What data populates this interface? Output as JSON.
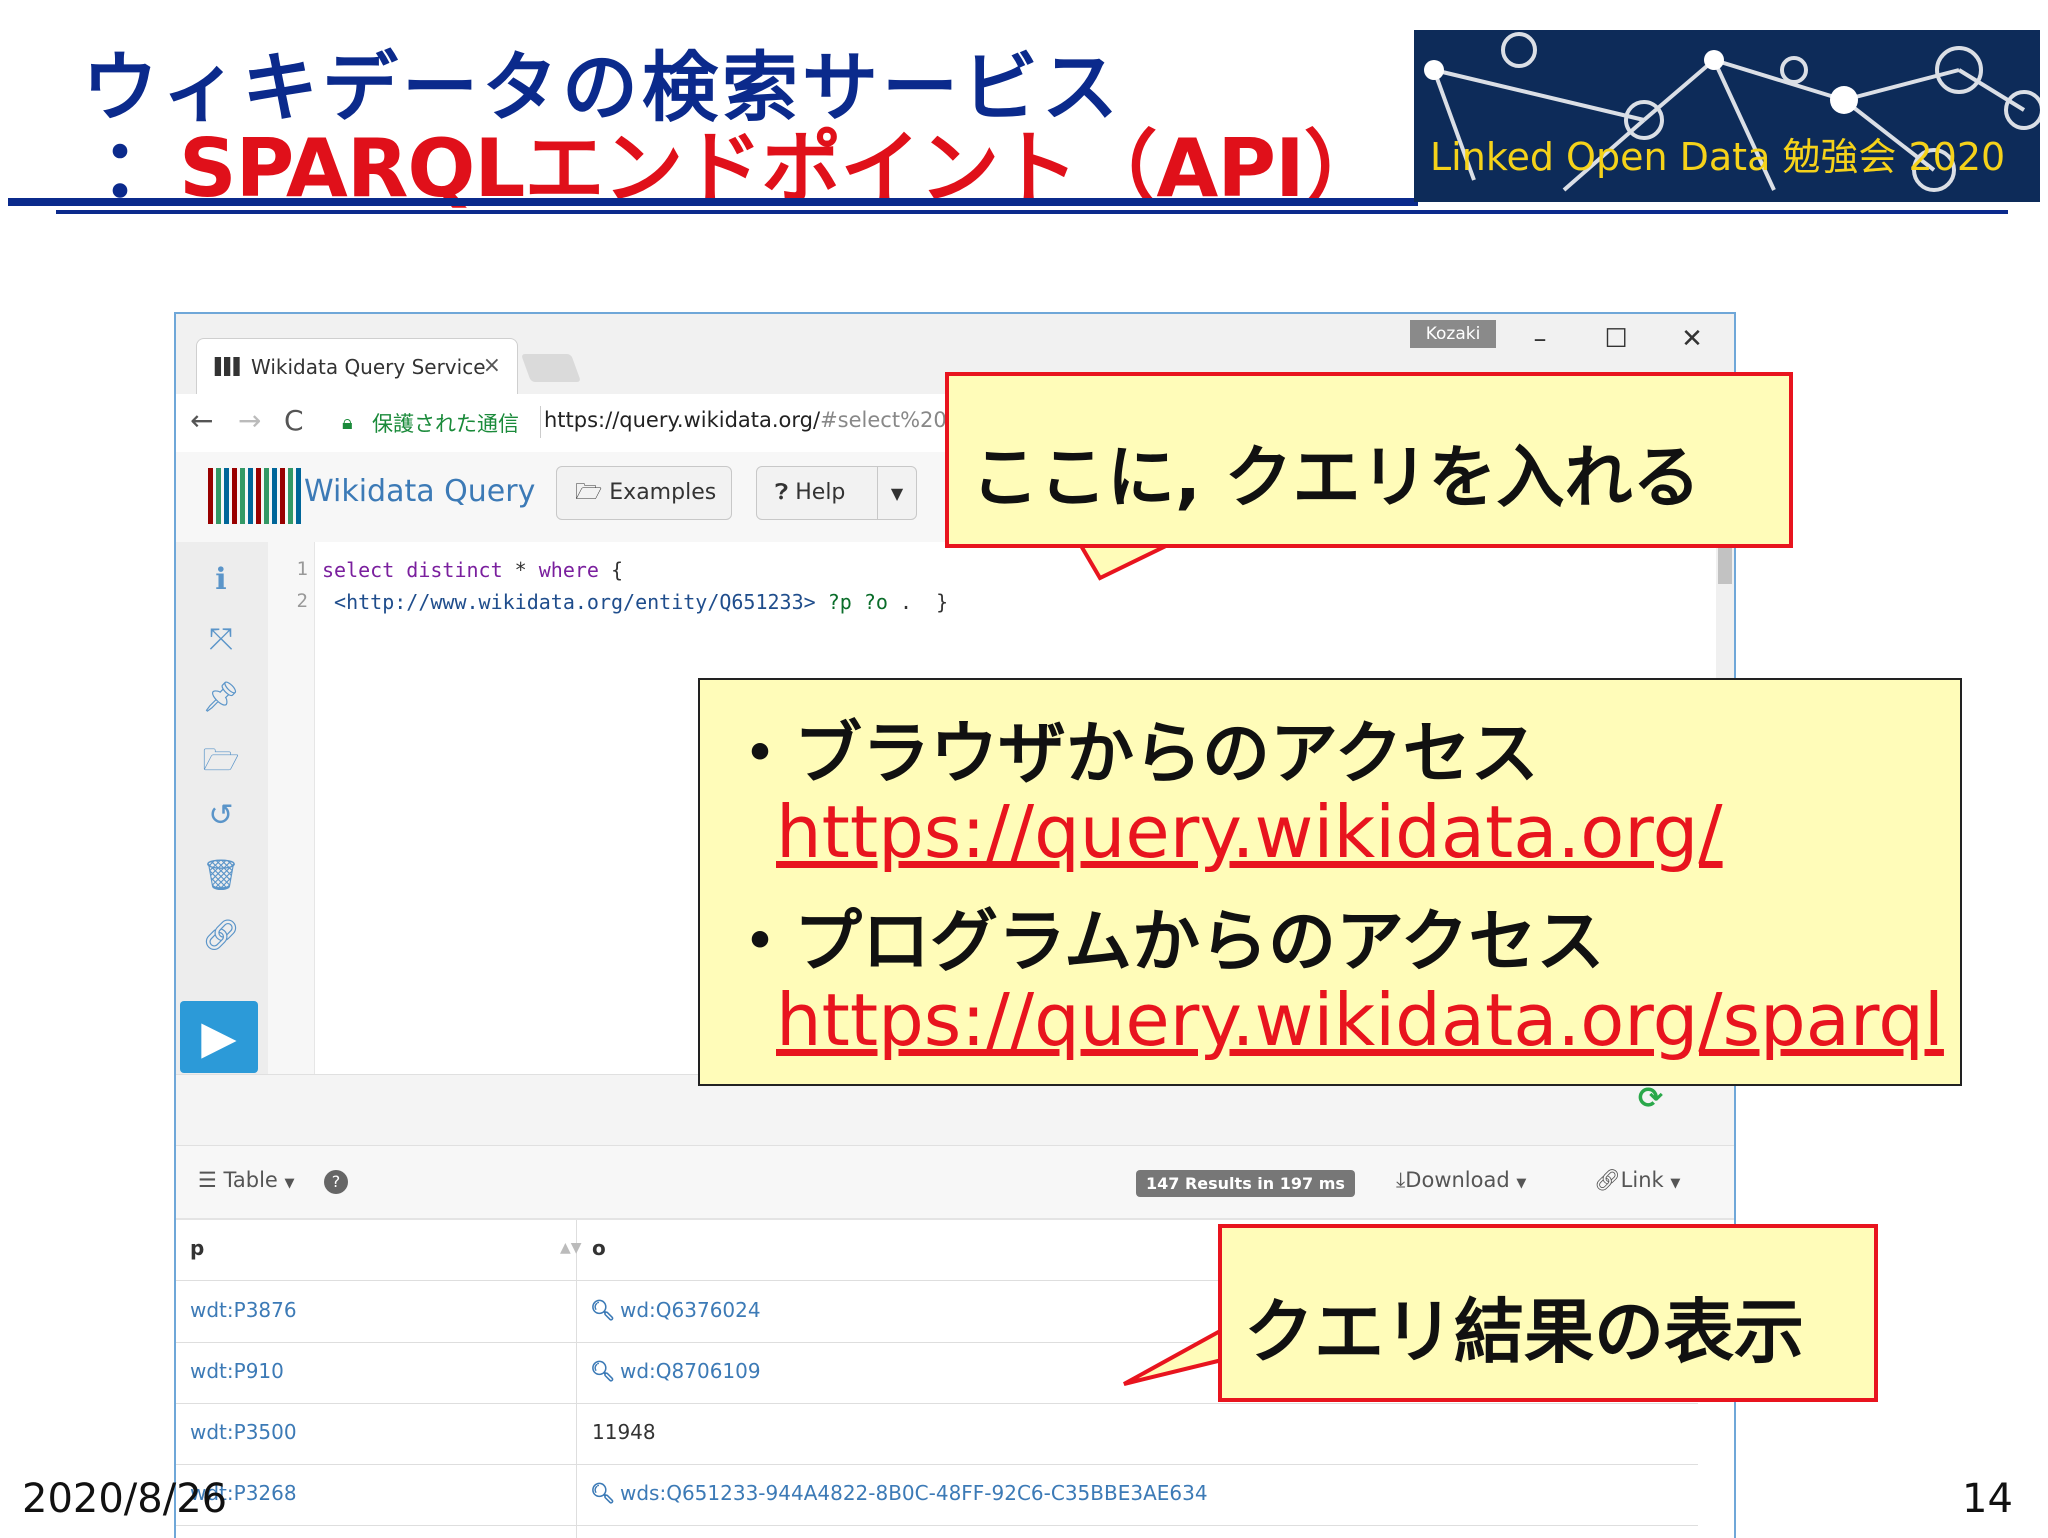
{
  "slide": {
    "title_line1": "ウィキデータの検索サービス",
    "title_line2_colon": "：",
    "title_line2": "SPARQLエンドポイント（API）",
    "banner": "Linked Open Data 勉強会 2020",
    "date": "2020/8/26",
    "page_number": "14"
  },
  "browser": {
    "tab_title": "Wikidata Query Service",
    "tab_close": "×",
    "user_badge": "Kozaki",
    "minimize": "–",
    "maximize": "☐",
    "close": "✕",
    "back": "←",
    "forward": "→",
    "reload": "C",
    "secure_label": "保護された通信",
    "url_host": "https://query.wikidata.org/",
    "url_rest": "#select%20d"
  },
  "app": {
    "logo_text": "Wikidata Query",
    "logo_colors": [
      "#990000",
      "#339966",
      "#006699",
      "#990000",
      "#339966",
      "#006699",
      "#990000",
      "#339966",
      "#006699",
      "#990000",
      "#339966",
      "#006699"
    ],
    "examples_label": "Examples",
    "help_label": "Help",
    "side_icons": [
      "info-icon",
      "expand-icon",
      "pin-icon",
      "open-folder-icon",
      "history-icon",
      "trash-icon",
      "link-icon"
    ],
    "run_label": "▶"
  },
  "editor": {
    "lines": [
      {
        "num": "1",
        "kw1": "select distinct",
        "mid": " * ",
        "kw2": "where",
        "end": " {"
      },
      {
        "num": "2",
        "iri": " <http://www.wikidata.org/entity/Q651233>",
        "vars": " ?p ?o",
        "end": " .  }"
      }
    ]
  },
  "results": {
    "view_label": "Table",
    "help_glyph": "?",
    "count_badge": "147 Results in 197 ms",
    "download_label": "Download",
    "link_label": "Link",
    "columns": [
      "p",
      "o"
    ],
    "rows": [
      {
        "p": "wdt:P3876",
        "o": "wd:Q6376024",
        "o_is_link": true
      },
      {
        "p": "wdt:P910",
        "o": "wd:Q8706109",
        "o_is_link": true
      },
      {
        "p": "wdt:P3500",
        "o": "11948",
        "o_is_link": false
      },
      {
        "p": "wdt:P3268",
        "o": "wds:Q651233-944A4822-8B0C-48FF-92C6-C35BBE3AE634",
        "o_is_link": true
      }
    ]
  },
  "callouts": {
    "query_here": "ここに, クエリを入れる",
    "results_display": "クエリ結果の表示",
    "browser_access": "・ブラウザからのアクセス",
    "browser_url": "https://query.wikidata.org/",
    "program_access": "・プログラムからのアクセス",
    "program_url": "https://query.wikidata.org/sparql"
  }
}
